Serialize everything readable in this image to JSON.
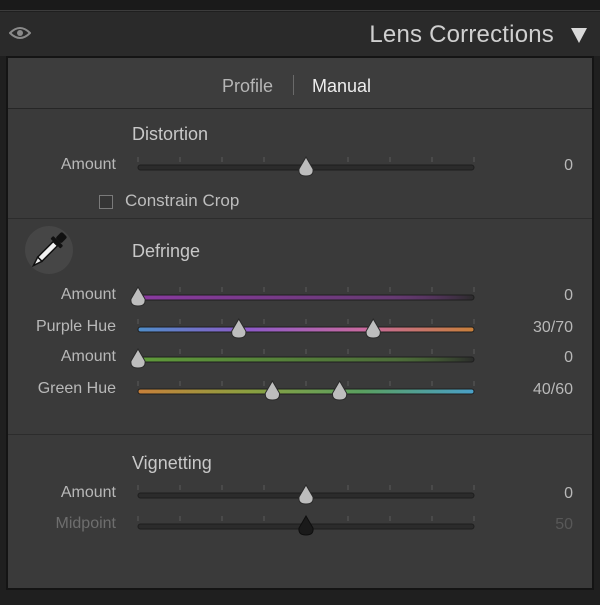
{
  "header": {
    "title": "Lens Corrections"
  },
  "tabs": [
    {
      "label": "Profile",
      "active": false
    },
    {
      "label": "Manual",
      "active": true
    }
  ],
  "sections": {
    "distortion": {
      "title": "Distortion",
      "amount": {
        "label": "Amount",
        "value": "0",
        "thumb": 0.5
      },
      "constrain_crop": {
        "label": "Constrain Crop",
        "checked": false
      }
    },
    "defringe": {
      "title": "Defringe",
      "purple_amount": {
        "label": "Amount",
        "value": "0",
        "thumb": 0.0
      },
      "purple_hue": {
        "label": "Purple Hue",
        "value": "30/70",
        "thumbs": [
          0.3,
          0.7
        ]
      },
      "green_amount": {
        "label": "Amount",
        "value": "0",
        "thumb": 0.0
      },
      "green_hue": {
        "label": "Green Hue",
        "value": "40/60",
        "thumbs": [
          0.4,
          0.6
        ]
      }
    },
    "vignetting": {
      "title": "Vignetting",
      "amount": {
        "label": "Amount",
        "value": "0",
        "thumb": 0.5
      },
      "midpoint": {
        "label": "Midpoint",
        "value": "50",
        "thumb": 0.5,
        "disabled": true
      }
    }
  },
  "colors": {
    "panel_bg": "#3a3a3a",
    "purple_track": "#8a3aa0",
    "green_track": "#5f9a3a",
    "hue_track_purple": [
      "#4f8ec9",
      "#8f5ac8",
      "#c86aa0",
      "#c8803a"
    ],
    "hue_track_green": [
      "#c8803a",
      "#8aa040",
      "#5aa060",
      "#4aa0c8"
    ]
  },
  "icons": {
    "visibility": "eye-icon",
    "collapse": "triangle-down-icon",
    "eyedropper": "eyedropper-icon"
  }
}
